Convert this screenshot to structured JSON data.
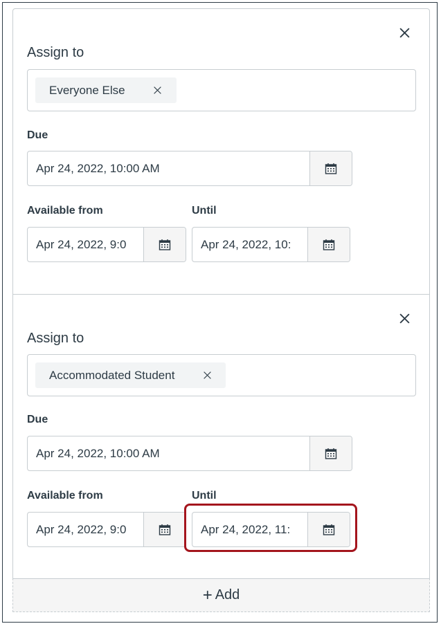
{
  "sections": [
    {
      "assign_to_label": "Assign to",
      "assignee": "Everyone Else",
      "due_label": "Due",
      "due_value": "Apr 24, 2022, 10:00 AM",
      "available_from_label": "Available from",
      "available_from_value": "Apr 24, 2022, 9:0",
      "until_label": "Until",
      "until_value": "Apr 24, 2022, 10:"
    },
    {
      "assign_to_label": "Assign to",
      "assignee": "Accommodated Student",
      "due_label": "Due",
      "due_value": "Apr 24, 2022, 10:00 AM",
      "available_from_label": "Available from",
      "available_from_value": "Apr 24, 2022, 9:0",
      "until_label": "Until",
      "until_value": "Apr 24, 2022, 11:"
    }
  ],
  "add_label": "Add",
  "icons": {
    "close": "close-icon",
    "remove_tag": "remove-tag-icon",
    "calendar": "calendar-icon",
    "plus": "plus-icon"
  },
  "colors": {
    "text": "#2d3b45",
    "border": "#c7cdd1",
    "highlight": "#a4151d",
    "button_bg": "#f5f5f5",
    "tag_bg": "#f2f4f5"
  }
}
